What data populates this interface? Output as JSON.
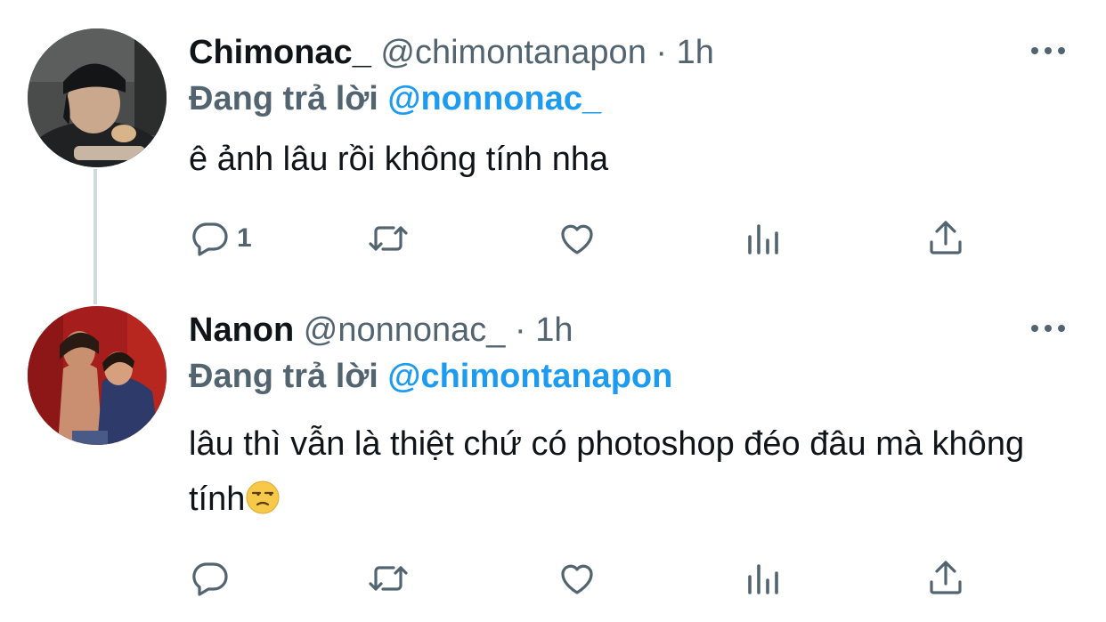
{
  "tweets": [
    {
      "display_name": "Chimonac_",
      "handle": "@chimontanapon",
      "separator": "·",
      "time": "1h",
      "reply_prefix": "Đang trả lời",
      "reply_to": "@nonnonac_",
      "text": "ê ảnh lâu rồi không tính nha",
      "reply_count": "1"
    },
    {
      "display_name": "Nanon",
      "handle": "@nonnonac_",
      "separator": "·",
      "time": "1h",
      "reply_prefix": "Đang trả lời",
      "reply_to": "@chimontanapon",
      "text": "lâu thì vẫn là thiệt chứ có photoshop đéo đâu mà không tính",
      "emoji": "unamused-face",
      "reply_count": ""
    }
  ],
  "icons": [
    "reply-icon",
    "retweet-icon",
    "like-icon",
    "analytics-icon",
    "share-icon",
    "more-icon"
  ],
  "colors": {
    "accent": "#1d9bf0",
    "muted": "#536471",
    "text": "#0f1419",
    "thread_line": "#cfd9de"
  }
}
